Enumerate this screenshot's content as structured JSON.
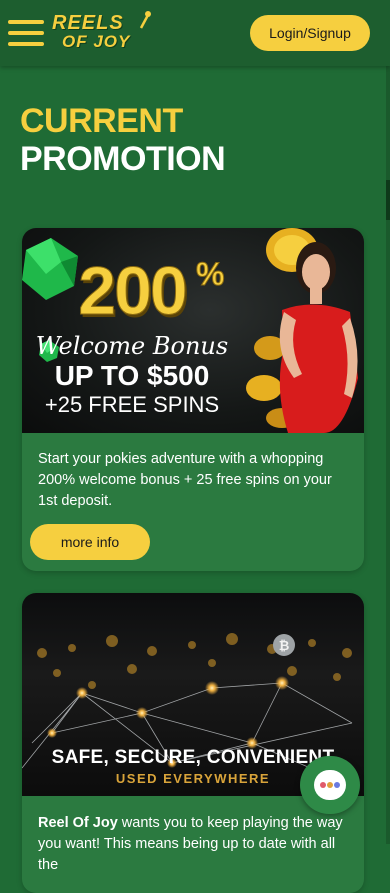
{
  "header": {
    "logo_line1": "REELS",
    "logo_line2": "OF JOY",
    "login_label": "Login/Signup"
  },
  "page": {
    "heading_line1": "CURRENT",
    "heading_line2": "PROMOTION"
  },
  "promotions": [
    {
      "banner": {
        "big_number": "200",
        "percent": "%",
        "welcome": "Welcome Bonus",
        "up_to": "UP TO $500",
        "free_spins": "+25 FREE SPINS"
      },
      "description": "Start your pokies adventure with a whopping 200% welcome bonus + 25 free spins on your 1st deposit.",
      "button_label": "more info"
    },
    {
      "banner": {
        "title": "SAFE, SECURE, CONVENIENT",
        "subtitle": "USED EVERYWHERE"
      },
      "description_brand": "Reel Of Joy",
      "description_rest": " wants you to keep playing the way you want! This means being up to date with all the"
    }
  ],
  "chat": {
    "icon": "chat-icon"
  },
  "colors": {
    "accent": "#f6cf3f",
    "background": "#1f6b35",
    "card": "#2b7a40",
    "header": "#1d5e2f"
  }
}
